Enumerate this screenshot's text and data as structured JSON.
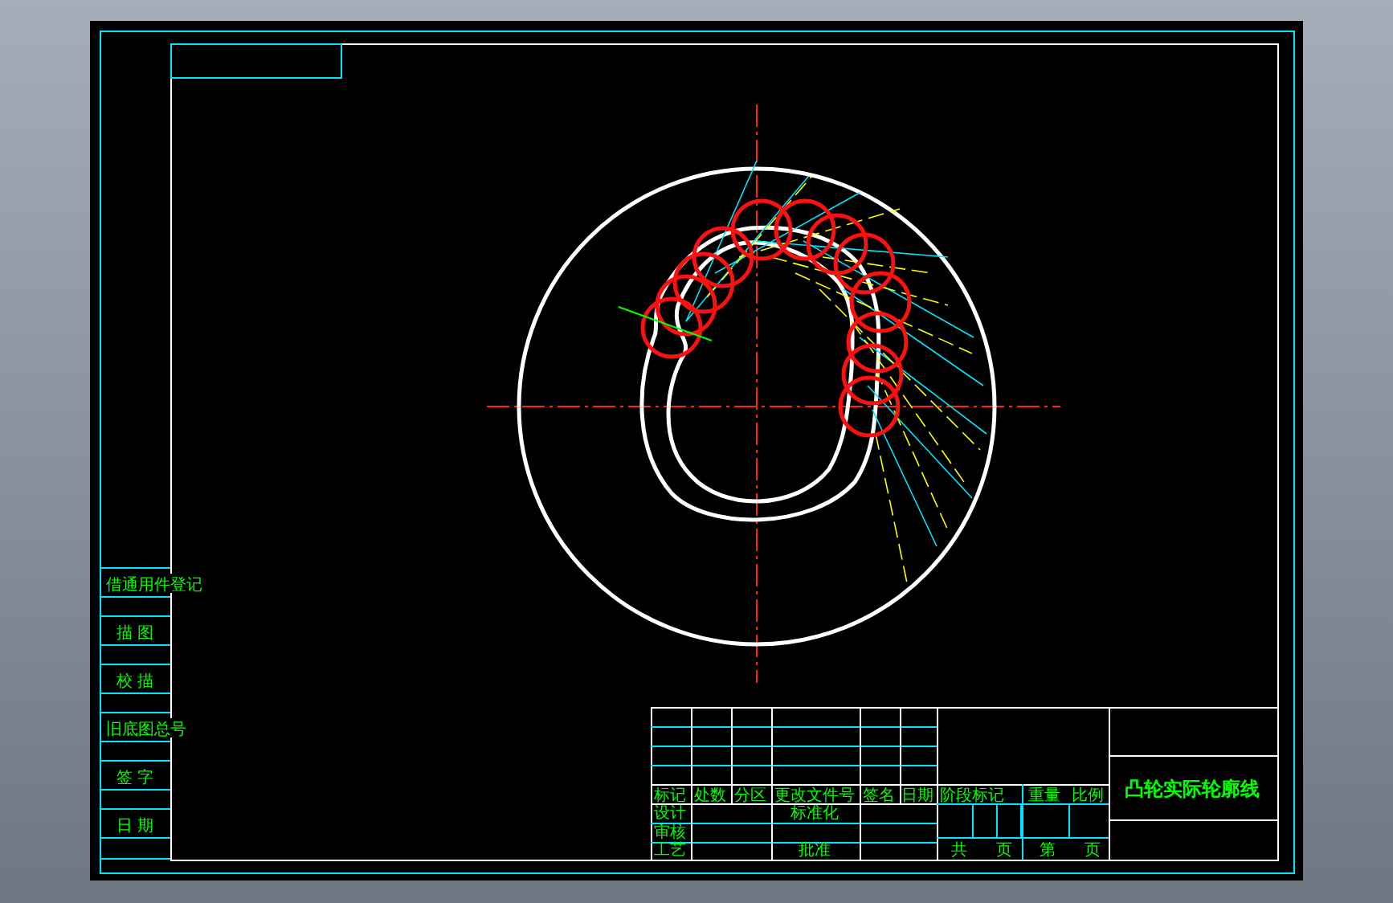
{
  "left_block": {
    "labels": [
      "借通用件登记",
      "描 图",
      "校 描",
      "旧底图总号",
      "签 字",
      "日 期"
    ]
  },
  "title_block": {
    "revision_header": [
      "标记",
      "处数",
      "分区",
      "更改文件号",
      "签名",
      "日期"
    ],
    "signature_labels": [
      "设计",
      "标准化",
      "审核",
      "工艺",
      "批准"
    ],
    "stage_header": [
      "阶段标记",
      "重量",
      "比例"
    ],
    "sheet_count": [
      "共",
      "页",
      "第",
      "页"
    ],
    "drawing_title": "凸轮实际轮廓线"
  }
}
